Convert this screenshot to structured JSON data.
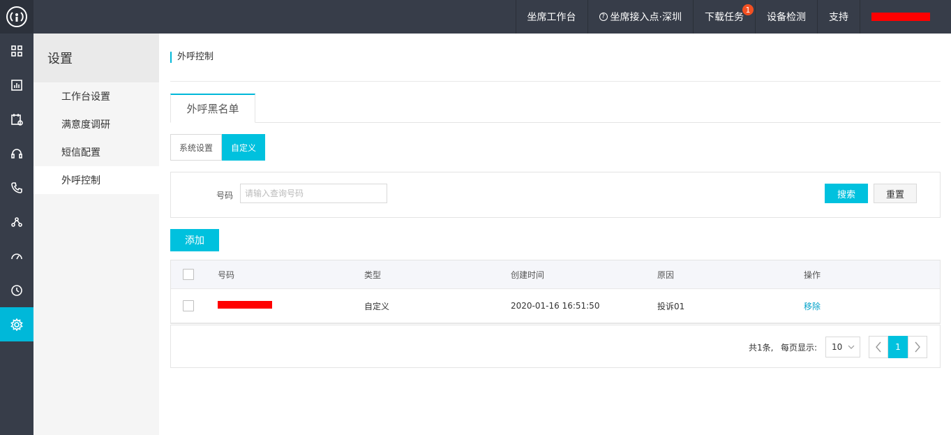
{
  "topnav": {
    "workbench": "坐席工作台",
    "access_point": "坐席接入点·深圳",
    "download_tasks": "下载任务",
    "download_badge": "1",
    "device_check": "设备检测",
    "support": "支持"
  },
  "rail": {
    "items": [
      "grid-icon",
      "chart-icon",
      "calendar-icon",
      "headset-icon",
      "phone-icon",
      "flow-icon",
      "gauge-icon",
      "clock-icon",
      "settings-icon"
    ],
    "active_index": 8,
    "accent_color": "#00b8d9"
  },
  "sidebar": {
    "title": "设置",
    "items": [
      {
        "label": "工作台设置"
      },
      {
        "label": "满意度调研"
      },
      {
        "label": "短信配置"
      },
      {
        "label": "外呼控制"
      }
    ],
    "active_index": 3
  },
  "main": {
    "breadcrumb": "外呼控制",
    "tab_label": "外呼黑名单",
    "segments": [
      "系统设置",
      "自定义"
    ],
    "active_segment": 1,
    "filter": {
      "number_label": "号码",
      "number_placeholder": "请输入查询号码",
      "number_value": "",
      "search_label": "搜索",
      "reset_label": "重置"
    },
    "add_label": "添加",
    "table": {
      "headers": [
        "号码",
        "类型",
        "创建时间",
        "原因",
        "操作"
      ],
      "rows": [
        {
          "number": "[redacted]",
          "type": "自定义",
          "created": "2020-01-16 16:51:50",
          "reason": "投诉01",
          "action": "移除"
        }
      ]
    },
    "pagination": {
      "total": "共1条,",
      "per_page_label": "每页显示:",
      "page_size": "10",
      "current_page": "1"
    }
  }
}
